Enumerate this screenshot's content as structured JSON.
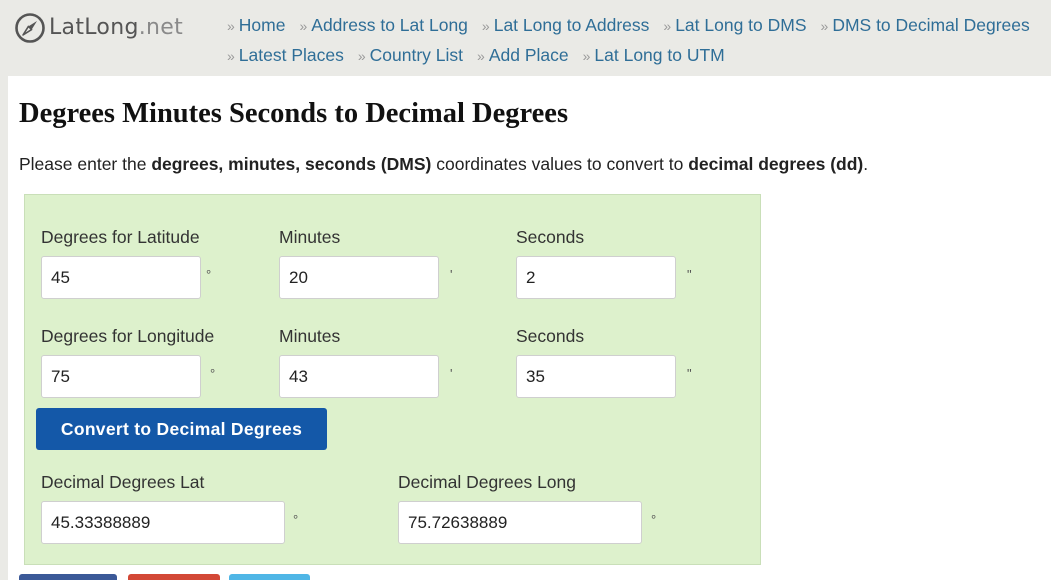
{
  "brand": {
    "name": "LatLong",
    "tld": ".net"
  },
  "nav": {
    "separator": "»",
    "row1": [
      "Home",
      "Address to Lat Long",
      "Lat Long to Address",
      "Lat Long to DMS",
      "DMS to Decimal Degrees"
    ],
    "row2": [
      "Latest Places",
      "Country List",
      "Add Place",
      "Lat Long to UTM"
    ]
  },
  "page": {
    "title": "Degrees Minutes Seconds to Decimal Degrees",
    "intro_pre": "Please enter the ",
    "intro_bold1": "degrees, minutes, seconds (DMS)",
    "intro_mid": " coordinates values to convert to ",
    "intro_bold2": "decimal degrees (dd)",
    "intro_post": "."
  },
  "form": {
    "lat_degrees_label": "Degrees for Latitude",
    "lat_minutes_label": "Minutes",
    "lat_seconds_label": "Seconds",
    "lat_degrees": "45",
    "lat_minutes": "20",
    "lat_seconds": "2",
    "lon_degrees_label": "Degrees for Longitude",
    "lon_minutes_label": "Minutes",
    "lon_seconds_label": "Seconds",
    "lon_degrees": "75",
    "lon_minutes": "43",
    "lon_seconds": "35",
    "degree_symbol": "°",
    "minute_symbol": "'",
    "second_symbol": "\"",
    "convert_button": "Convert to Decimal Degrees",
    "dd_lat_label": "Decimal Degrees Lat",
    "dd_lon_label": "Decimal Degrees Long",
    "dd_lat": "45.33388889",
    "dd_lon": "75.72638889"
  },
  "colors": {
    "link": "#2f6e97",
    "panel": "#ddf1cc",
    "button": "#1458a8",
    "share_facebook": "#3b5998",
    "share_google": "#d34836",
    "share_twitter": "#4fb6e6"
  }
}
